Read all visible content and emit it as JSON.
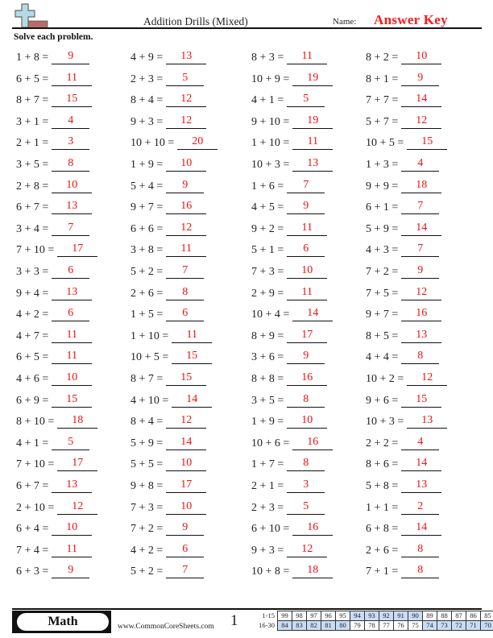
{
  "header": {
    "logo_icon": "plus-sign-icon",
    "title": "Addition Drills (Mixed)",
    "name_label": "Name:",
    "answer_key": "Answer Key"
  },
  "instructions": "Solve each problem.",
  "colors": {
    "answer": "#ee1111",
    "answer_key": "#ff1a1a",
    "logo_plus": "#b4dbe5",
    "logo_bar": "#b86b6b",
    "score_highlight": "#c9dcf7"
  },
  "problems": [
    [
      {
        "q": "1 + 8 =",
        "a": "9"
      },
      {
        "q": "4 + 9 =",
        "a": "13"
      },
      {
        "q": "8 + 3 =",
        "a": "11"
      },
      {
        "q": "8 + 2 =",
        "a": "10"
      }
    ],
    [
      {
        "q": "6 + 5 =",
        "a": "11"
      },
      {
        "q": "2 + 3 =",
        "a": "5"
      },
      {
        "q": "10 + 9 =",
        "a": "19"
      },
      {
        "q": "8 + 1 =",
        "a": "9"
      }
    ],
    [
      {
        "q": "8 + 7 =",
        "a": "15"
      },
      {
        "q": "8 + 4 =",
        "a": "12"
      },
      {
        "q": "4 + 1 =",
        "a": "5"
      },
      {
        "q": "7 + 7 =",
        "a": "14"
      }
    ],
    [
      {
        "q": "3 + 1 =",
        "a": "4"
      },
      {
        "q": "9 + 3 =",
        "a": "12"
      },
      {
        "q": "9 + 10 =",
        "a": "19"
      },
      {
        "q": "5 + 7 =",
        "a": "12"
      }
    ],
    [
      {
        "q": "2 + 1 =",
        "a": "3"
      },
      {
        "q": "10 + 10 =",
        "a": "20"
      },
      {
        "q": "1 + 10 =",
        "a": "11"
      },
      {
        "q": "10 + 5 =",
        "a": "15"
      }
    ],
    [
      {
        "q": "3 + 5 =",
        "a": "8"
      },
      {
        "q": "1 + 9 =",
        "a": "10"
      },
      {
        "q": "10 + 3 =",
        "a": "13"
      },
      {
        "q": "1 + 3 =",
        "a": "4"
      }
    ],
    [
      {
        "q": "2 + 8 =",
        "a": "10"
      },
      {
        "q": "5 + 4 =",
        "a": "9"
      },
      {
        "q": "1 + 6 =",
        "a": "7"
      },
      {
        "q": "9 + 9 =",
        "a": "18"
      }
    ],
    [
      {
        "q": "6 + 7 =",
        "a": "13"
      },
      {
        "q": "9 + 7 =",
        "a": "16"
      },
      {
        "q": "4 + 5 =",
        "a": "9"
      },
      {
        "q": "6 + 1 =",
        "a": "7"
      }
    ],
    [
      {
        "q": "3 + 4 =",
        "a": "7"
      },
      {
        "q": "6 + 6 =",
        "a": "12"
      },
      {
        "q": "9 + 2 =",
        "a": "11"
      },
      {
        "q": "5 + 9 =",
        "a": "14"
      }
    ],
    [
      {
        "q": "7 + 10 =",
        "a": "17"
      },
      {
        "q": "3 + 8 =",
        "a": "11"
      },
      {
        "q": "5 + 1 =",
        "a": "6"
      },
      {
        "q": "4 + 3 =",
        "a": "7"
      }
    ],
    [
      {
        "q": "3 + 3 =",
        "a": "6"
      },
      {
        "q": "5 + 2 =",
        "a": "7"
      },
      {
        "q": "7 + 3 =",
        "a": "10"
      },
      {
        "q": "7 + 2 =",
        "a": "9"
      }
    ],
    [
      {
        "q": "9 + 4 =",
        "a": "13"
      },
      {
        "q": "2 + 6 =",
        "a": "8"
      },
      {
        "q": "2 + 9 =",
        "a": "11"
      },
      {
        "q": "7 + 5 =",
        "a": "12"
      }
    ],
    [
      {
        "q": "4 + 2 =",
        "a": "6"
      },
      {
        "q": "1 + 5 =",
        "a": "6"
      },
      {
        "q": "10 + 4 =",
        "a": "14"
      },
      {
        "q": "9 + 7 =",
        "a": "16"
      }
    ],
    [
      {
        "q": "4 + 7 =",
        "a": "11"
      },
      {
        "q": "1 + 10 =",
        "a": "11"
      },
      {
        "q": "8 + 9 =",
        "a": "17"
      },
      {
        "q": "8 + 5 =",
        "a": "13"
      }
    ],
    [
      {
        "q": "6 + 5 =",
        "a": "11"
      },
      {
        "q": "10 + 5 =",
        "a": "15"
      },
      {
        "q": "3 + 6 =",
        "a": "9"
      },
      {
        "q": "4 + 4 =",
        "a": "8"
      }
    ],
    [
      {
        "q": "4 + 6 =",
        "a": "10"
      },
      {
        "q": "8 + 7 =",
        "a": "15"
      },
      {
        "q": "8 + 8 =",
        "a": "16"
      },
      {
        "q": "10 + 2 =",
        "a": "12"
      }
    ],
    [
      {
        "q": "6 + 9 =",
        "a": "15"
      },
      {
        "q": "4 + 10 =",
        "a": "14"
      },
      {
        "q": "3 + 5 =",
        "a": "8"
      },
      {
        "q": "9 + 6 =",
        "a": "15"
      }
    ],
    [
      {
        "q": "8 + 10 =",
        "a": "18"
      },
      {
        "q": "8 + 4 =",
        "a": "12"
      },
      {
        "q": "1 + 9 =",
        "a": "10"
      },
      {
        "q": "10 + 3 =",
        "a": "13"
      }
    ],
    [
      {
        "q": "4 + 1 =",
        "a": "5"
      },
      {
        "q": "5 + 9 =",
        "a": "14"
      },
      {
        "q": "10 + 6 =",
        "a": "16"
      },
      {
        "q": "2 + 2 =",
        "a": "4"
      }
    ],
    [
      {
        "q": "7 + 10 =",
        "a": "17"
      },
      {
        "q": "5 + 5 =",
        "a": "10"
      },
      {
        "q": "1 + 7 =",
        "a": "8"
      },
      {
        "q": "8 + 6 =",
        "a": "14"
      }
    ],
    [
      {
        "q": "6 + 7 =",
        "a": "13"
      },
      {
        "q": "9 + 8 =",
        "a": "17"
      },
      {
        "q": "2 + 1 =",
        "a": "3"
      },
      {
        "q": "5 + 8 =",
        "a": "13"
      }
    ],
    [
      {
        "q": "2 + 10 =",
        "a": "12"
      },
      {
        "q": "7 + 3 =",
        "a": "10"
      },
      {
        "q": "2 + 3 =",
        "a": "5"
      },
      {
        "q": "1 + 1 =",
        "a": "2"
      }
    ],
    [
      {
        "q": "6 + 4 =",
        "a": "10"
      },
      {
        "q": "7 + 2 =",
        "a": "9"
      },
      {
        "q": "6 + 10 =",
        "a": "16"
      },
      {
        "q": "6 + 8 =",
        "a": "14"
      }
    ],
    [
      {
        "q": "7 + 4 =",
        "a": "11"
      },
      {
        "q": "4 + 2 =",
        "a": "6"
      },
      {
        "q": "9 + 3 =",
        "a": "12"
      },
      {
        "q": "2 + 6 =",
        "a": "8"
      }
    ],
    [
      {
        "q": "6 + 3 =",
        "a": "9"
      },
      {
        "q": "5 + 2 =",
        "a": "7"
      },
      {
        "q": "10 + 8 =",
        "a": "18"
      },
      {
        "q": "7 + 1 =",
        "a": "8"
      }
    ]
  ],
  "footer": {
    "subject": "Math",
    "website": "www.CommonCoreSheets.com",
    "page_number": "1",
    "score_table": {
      "rows": [
        {
          "label": "1-15",
          "values": [
            "99",
            "98",
            "97",
            "96",
            "95",
            "94",
            "93",
            "92",
            "91",
            "90",
            "89",
            "88",
            "87",
            "86",
            "85"
          ],
          "highlighted": [
            false,
            false,
            false,
            false,
            false,
            true,
            true,
            true,
            true,
            true,
            false,
            false,
            false,
            false,
            false
          ]
        },
        {
          "label": "16-30",
          "values": [
            "84",
            "83",
            "82",
            "81",
            "80",
            "79",
            "78",
            "77",
            "76",
            "75",
            "74",
            "73",
            "72",
            "71",
            "70"
          ],
          "highlighted": [
            true,
            true,
            true,
            true,
            true,
            false,
            false,
            false,
            false,
            false,
            true,
            true,
            true,
            true,
            true
          ]
        }
      ]
    }
  }
}
